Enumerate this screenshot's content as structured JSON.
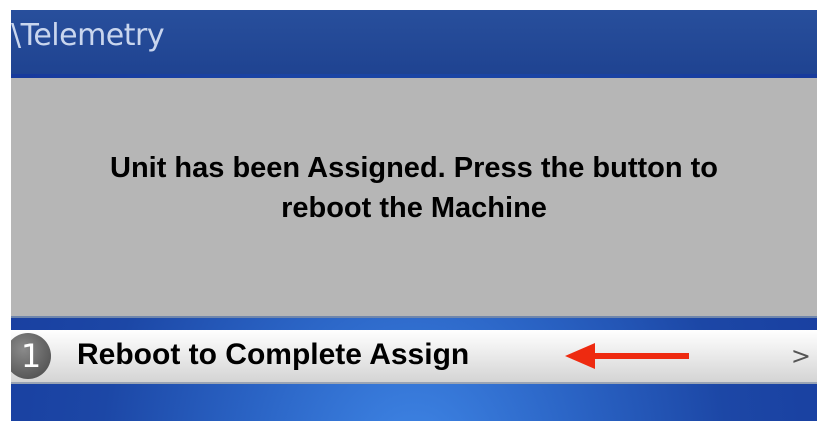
{
  "header": {
    "title": "\\Telemetry"
  },
  "message": {
    "line1": "Unit has been Assigned. Press the button to",
    "line2": "reboot the Machine"
  },
  "menu": {
    "items": [
      {
        "number": "1",
        "label": "Reboot to Complete Assign",
        "chevron": ">",
        "icon": "chevron-right-icon"
      }
    ]
  },
  "annotation": {
    "icon": "arrow-left-icon",
    "color": "#ee2a10"
  },
  "colors": {
    "title_bar": "#1f4391",
    "panel": "#b6b6b6",
    "background": "#1c47a6"
  }
}
